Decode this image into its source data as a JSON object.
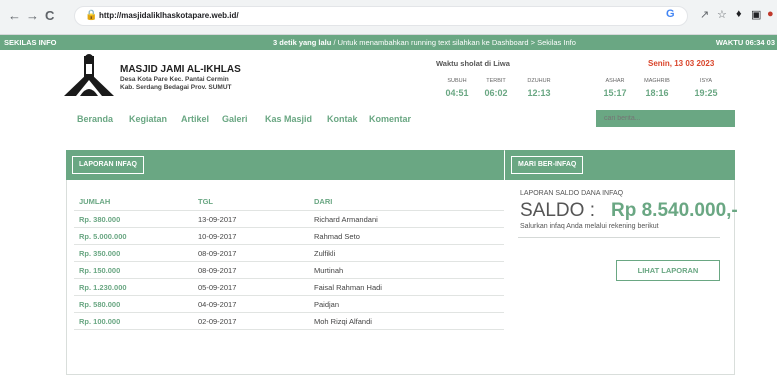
{
  "browser": {
    "url": "http://masjidaliklhaskotapare.web.id/"
  },
  "infobar": {
    "left": "SEKILAS INFO",
    "time_ago": "3 detik yang lalu",
    "message": " / Untuk menambahkan running text silahkan ke Dashboard > Sekilas Info",
    "right": "WAKTU 06:34 03"
  },
  "site": {
    "name": "MASJID JAMI AL-IKHLAS",
    "address_line1": "Desa Kota Pare Kec. Pantai Cermin",
    "address_line2": "Kab. Serdang Bedagai Prov. SUMUT"
  },
  "prayer": {
    "title": "Waktu sholat di Liwa",
    "date": "Senin, 13 03 2023",
    "times": [
      {
        "label": "SUBUH",
        "time": "04:51"
      },
      {
        "label": "TERBIT",
        "time": "06:02"
      },
      {
        "label": "DZUHUR",
        "time": "12:13"
      },
      {
        "label": "ASHAR",
        "time": "15:17"
      },
      {
        "label": "MAGHRIB",
        "time": "18:16"
      },
      {
        "label": "ISYA",
        "time": "19:25"
      }
    ]
  },
  "menu": [
    {
      "label": "Beranda"
    },
    {
      "label": "Kegiatan"
    },
    {
      "label": "Artikel"
    },
    {
      "label": "Galeri"
    },
    {
      "label": "Kas Masjid"
    },
    {
      "label": "Kontak"
    },
    {
      "label": "Komentar"
    }
  ],
  "search": {
    "placeholder": "cari berita..."
  },
  "laporan": {
    "button": "LAPORAN INFAQ",
    "headers": {
      "jumlah": "JUMLAH",
      "tgl": "TGL",
      "dari": "DARI"
    },
    "rows": [
      {
        "jumlah": "Rp. 380.000",
        "tgl": "13-09-2017",
        "dari": "Richard Armandani"
      },
      {
        "jumlah": "Rp. 5.000.000",
        "tgl": "10-09-2017",
        "dari": "Rahmad Seto"
      },
      {
        "jumlah": "Rp. 350.000",
        "tgl": "08-09-2017",
        "dari": "Zulfikli"
      },
      {
        "jumlah": "Rp. 150.000",
        "tgl": "08-09-2017",
        "dari": "Murtinah"
      },
      {
        "jumlah": "Rp. 1.230.000",
        "tgl": "05-09-2017",
        "dari": "Faisal Rahman Hadi"
      },
      {
        "jumlah": "Rp. 580.000",
        "tgl": "04-09-2017",
        "dari": "Paidjan"
      },
      {
        "jumlah": "Rp. 100.000",
        "tgl": "02-09-2017",
        "dari": "Moh Rizqi Alfandi"
      }
    ]
  },
  "infaq": {
    "button": "MARI BER-INFAQ",
    "label": "LAPORAN SALDO DANA INFAQ",
    "saldo_key": "SALDO :",
    "saldo_value": "Rp 8.540.000,-",
    "note": "Salurkan infaq Anda melalui rekening berikut",
    "lihat_button": "LIHAT LAPORAN"
  },
  "colors": {
    "accent": "#6aa783",
    "date_red": "#d9452b"
  }
}
